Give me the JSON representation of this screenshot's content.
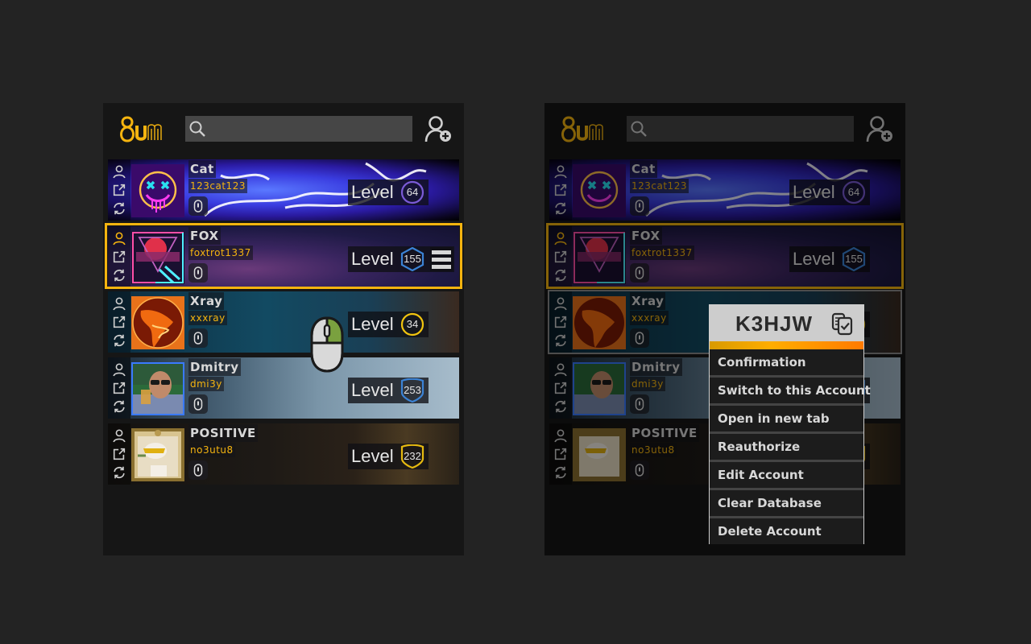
{
  "app": {
    "logo_text": "SUM",
    "search": {
      "placeholder": "",
      "value": ""
    },
    "add_account_icon": "add-user-icon",
    "colors": {
      "accent": "#f5b40f",
      "panel_bg": "#161616",
      "search_bg": "#464646",
      "page_bg": "#232323"
    }
  },
  "level_label": "Level",
  "accounts": [
    {
      "name": "Cat",
      "login": "123cat123",
      "level": "64",
      "badge_shape": "circle",
      "badge_color": "#7b5bd6",
      "selected": false
    },
    {
      "name": "FOX",
      "login": "foxtrot1337",
      "level": "155",
      "badge_shape": "hexagon",
      "badge_color": "#3b83d6",
      "selected": true
    },
    {
      "name": "Xray",
      "login": "xxxray",
      "level": "34",
      "badge_shape": "circle",
      "badge_color": "#f1c40f",
      "selected": false
    },
    {
      "name": "Dmitry",
      "login": "dmi3y",
      "level": "253",
      "badge_shape": "shield",
      "badge_color": "#3b83d6",
      "selected": false
    },
    {
      "name": "POSITIVE",
      "login": "no3utu8",
      "level": "232",
      "badge_shape": "shield",
      "badge_color": "#e5b910",
      "selected": false
    }
  ],
  "row_icons": [
    "user-icon",
    "open-external-icon",
    "refresh-icon",
    "steam-guard-icon"
  ],
  "menu_button_icon": "hamburger-menu-icon",
  "mouse_hint": {
    "icon": "mouse-right-click-icon",
    "highlight_color": "#7aa13f"
  },
  "context_menu": {
    "code": "K3HJW",
    "copy_icon": "copy-code-icon",
    "items": [
      "Confirmation",
      "Switch to this Account",
      "Open in new tab",
      "Reauthorize",
      "Edit Account",
      "Clear Database",
      "Delete Account"
    ]
  }
}
